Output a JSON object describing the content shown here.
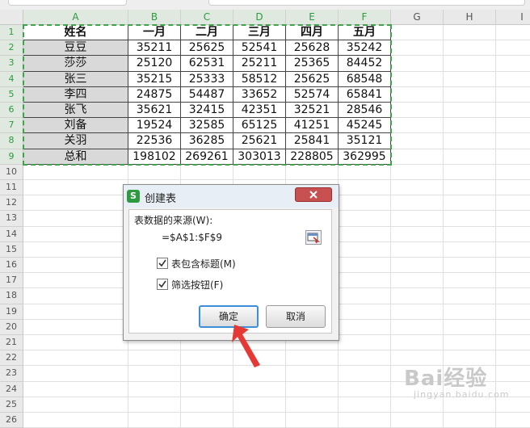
{
  "columns": [
    "A",
    "B",
    "C",
    "D",
    "E",
    "F",
    "G",
    "H",
    "I"
  ],
  "rows": [
    "1",
    "2",
    "3",
    "4",
    "5",
    "6",
    "7",
    "8",
    "9",
    "10",
    "11",
    "12",
    "13",
    "14",
    "15",
    "16",
    "17",
    "18",
    "19",
    "20",
    "21",
    "22",
    "23",
    "24",
    "25",
    "26"
  ],
  "table": {
    "header": [
      "姓名",
      "一月",
      "二月",
      "三月",
      "四月",
      "五月"
    ],
    "body": [
      [
        "豆豆",
        "35211",
        "25625",
        "52541",
        "25628",
        "35242"
      ],
      [
        "莎莎",
        "25120",
        "62531",
        "25211",
        "25365",
        "84452"
      ],
      [
        "张三",
        "35215",
        "25333",
        "58512",
        "25625",
        "68548"
      ],
      [
        "李四",
        "24875",
        "54487",
        "33652",
        "52574",
        "65841"
      ],
      [
        "张飞",
        "35621",
        "32415",
        "42351",
        "32521",
        "28546"
      ],
      [
        "刘备",
        "19524",
        "32585",
        "65125",
        "41251",
        "45245"
      ],
      [
        "关羽",
        "22536",
        "36285",
        "25621",
        "25841",
        "35121"
      ],
      [
        "总和",
        "198102",
        "269261",
        "303013",
        "228805",
        "362995"
      ]
    ]
  },
  "dialog": {
    "title": "创建表",
    "app_icon_letter": "S",
    "source_label": "表数据的来源(W):",
    "source_value": "=$A$1:$F$9",
    "checkbox_header": {
      "label": "表包含标题(M)",
      "checked": true
    },
    "checkbox_filter": {
      "label": "筛选按钮(F)",
      "checked": true
    },
    "ok_label": "确定",
    "cancel_label": "取消"
  },
  "watermark": {
    "main": "Bai经验",
    "sub": "jingyan.baidu.com"
  },
  "colors": {
    "selection_green": "#2e9a3f",
    "close_red": "#c75050",
    "arrow_red": "#e53935"
  }
}
